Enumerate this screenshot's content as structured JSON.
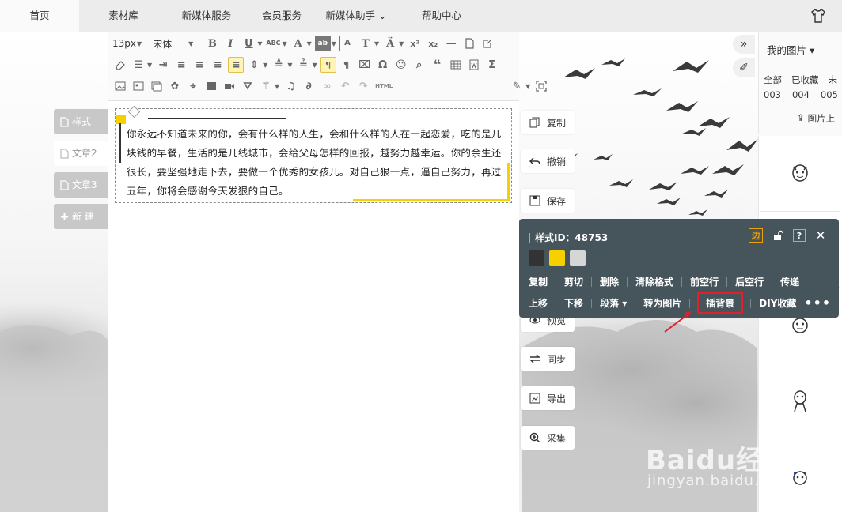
{
  "nav": {
    "items": [
      {
        "label": "首页",
        "active": true
      },
      {
        "label": "素材库"
      },
      {
        "label": "新媒体服务"
      },
      {
        "label": "会员服务"
      },
      {
        "label": "新媒体助手 ⌄"
      },
      {
        "label": "帮助中心"
      }
    ]
  },
  "side_tabs": [
    {
      "label": "样式",
      "active": false
    },
    {
      "label": "文章2",
      "active": true
    },
    {
      "label": "文章3",
      "active": false
    },
    {
      "label": "新 建",
      "active": false
    }
  ],
  "toolbar": {
    "font_size": "13px",
    "font_family": "宋体",
    "html_label": "HTML"
  },
  "content": {
    "paragraph": "你永远不知道未来的你，会有什么样的人生，会和什么样的人在一起恋爱，吃的是几块钱的早餐，生活的是几线城市，会给父母怎样的回报，越努力越幸运。你的余生还很长，要坚强地走下去，要做一个优秀的女孩儿。对自己狠一点，逼自己努力，再过五年，你将会感谢今天发狠的自己。"
  },
  "fab": {
    "copy": "复制",
    "undo": "撤销",
    "save": "保存",
    "preview": "预览",
    "sync": "同步",
    "export": "导出",
    "collect": "采集"
  },
  "popup": {
    "title": "样式ID：48753",
    "edge_label": "边",
    "help_label": "?",
    "close_label": "✕",
    "colors": [
      "#333333",
      "#f7d000",
      "#d6d6d6"
    ],
    "row1": [
      "复制",
      "剪切",
      "删除",
      "清除格式",
      "前空行",
      "后空行",
      "传递"
    ],
    "row2": [
      "上移",
      "下移",
      "段落 ▾",
      "转为图片",
      "插背景",
      "DIY收藏"
    ],
    "more": "•••"
  },
  "right_panel": {
    "title": "我的图片 ▾",
    "labels": [
      "全部",
      "已收藏",
      "未"
    ],
    "nums": [
      "003",
      "004",
      "005"
    ],
    "upload": "图片上"
  },
  "watermark": {
    "main": "Baidu经验",
    "sub": "jingyan.baidu.com"
  }
}
